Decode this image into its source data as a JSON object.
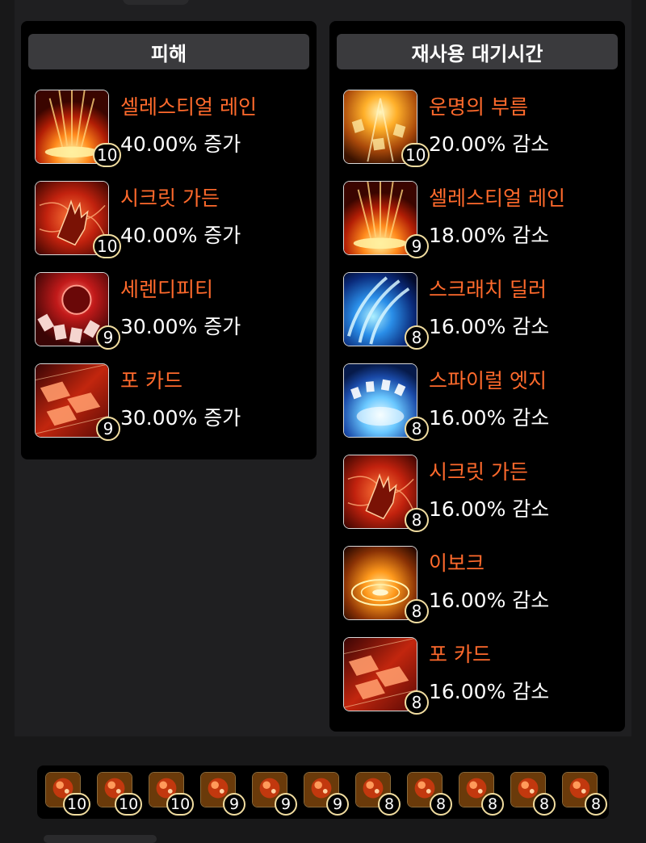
{
  "panels": {
    "damage": {
      "title": "피해",
      "items": [
        {
          "name": "셀레스티얼 레인",
          "value": "40.00% 증가",
          "level": "10",
          "icon": "celestial-rain-icon"
        },
        {
          "name": "시크릿 가든",
          "value": "40.00% 증가",
          "level": "10",
          "icon": "secret-garden-icon"
        },
        {
          "name": "세렌디피티",
          "value": "30.00% 증가",
          "level": "9",
          "icon": "serendipity-icon"
        },
        {
          "name": "포 카드",
          "value": "30.00% 증가",
          "level": "9",
          "icon": "four-card-icon"
        }
      ]
    },
    "cooldown": {
      "title": "재사용 대기시간",
      "items": [
        {
          "name": "운명의 부름",
          "value": "20.00% 감소",
          "level": "10",
          "icon": "call-of-fate-icon"
        },
        {
          "name": "셀레스티얼 레인",
          "value": "18.00% 감소",
          "level": "9",
          "icon": "celestial-rain-icon"
        },
        {
          "name": "스크래치 딜러",
          "value": "16.00% 감소",
          "level": "8",
          "icon": "scratch-dealer-icon"
        },
        {
          "name": "스파이럴 엣지",
          "value": "16.00% 감소",
          "level": "8",
          "icon": "spiral-edge-icon"
        },
        {
          "name": "시크릿 가든",
          "value": "16.00% 감소",
          "level": "8",
          "icon": "secret-garden-icon"
        },
        {
          "name": "이보크",
          "value": "16.00% 감소",
          "level": "8",
          "icon": "evoke-icon"
        },
        {
          "name": "포 카드",
          "value": "16.00% 감소",
          "level": "8",
          "icon": "four-card-icon"
        }
      ]
    }
  },
  "gems": [
    {
      "level": "10",
      "icon": "gem-icon"
    },
    {
      "level": "10",
      "icon": "gem-icon"
    },
    {
      "level": "10",
      "icon": "gem-icon"
    },
    {
      "level": "9",
      "icon": "gem-icon"
    },
    {
      "level": "9",
      "icon": "gem-icon"
    },
    {
      "level": "9",
      "icon": "gem-icon"
    },
    {
      "level": "8",
      "icon": "gem-icon"
    },
    {
      "level": "8",
      "icon": "gem-icon"
    },
    {
      "level": "8",
      "icon": "gem-icon"
    },
    {
      "level": "8",
      "icon": "gem-icon"
    },
    {
      "level": "8",
      "icon": "gem-icon"
    }
  ],
  "colors": {
    "skill_name": "#ff6a2c",
    "value_text": "#ffffff",
    "badge_border": "#f1dda0",
    "panel_bg": "#000000",
    "header_bg": "#3a3a3d"
  }
}
